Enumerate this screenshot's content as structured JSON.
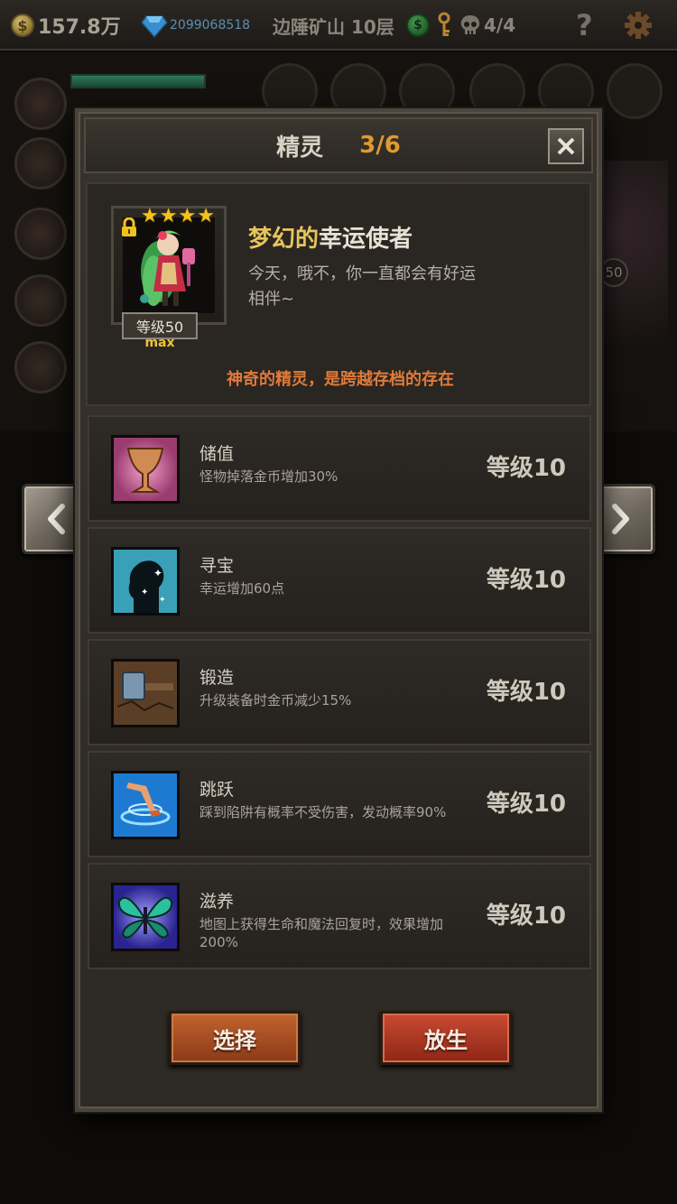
{
  "hud": {
    "gold": "157.8万",
    "gems": "2099068518",
    "floor": "边陲矿山 10层",
    "skulls": "4/4",
    "help": "?",
    "coin_symbol": "$",
    "green_coin_symbol": "$"
  },
  "background": {
    "badge_value": "50"
  },
  "dialog": {
    "title": "精灵",
    "count": "3/6",
    "spirit": {
      "stars": [
        "★",
        "★",
        "★",
        "★"
      ],
      "name_adjective": "梦幻的",
      "name_noun": "幸运使者",
      "description": "今天，哦不，你一直都会有好运相伴~",
      "level": "等级50",
      "max": "max",
      "note": "神奇的精灵，是跨越存档的存在"
    },
    "skills": [
      {
        "name": "储值",
        "desc": "怪物掉落金币增加30%",
        "level": "等级10",
        "icon": "chalice-icon"
      },
      {
        "name": "寻宝",
        "desc": "幸运增加60点",
        "level": "等级10",
        "icon": "silhouette-stars-icon"
      },
      {
        "name": "锻造",
        "desc": "升级装备时金币减少15%",
        "level": "等级10",
        "icon": "hammer-icon"
      },
      {
        "name": "跳跃",
        "desc": "踩到陷阱有概率不受伤害，发动概率90%",
        "level": "等级10",
        "icon": "jump-leg-icon"
      },
      {
        "name": "滋养",
        "desc": "地图上获得生命和魔法回复时，效果增加200%",
        "level": "等级10",
        "icon": "fairy-wings-icon"
      }
    ],
    "buttons": {
      "select": "选择",
      "release": "放生"
    }
  },
  "colors": {
    "accent_orange": "#e09a2e",
    "note_orange": "#e07a3a",
    "star_gold": "#f2c21c",
    "button_orange": "#c2632e",
    "button_red": "#c94a32"
  }
}
